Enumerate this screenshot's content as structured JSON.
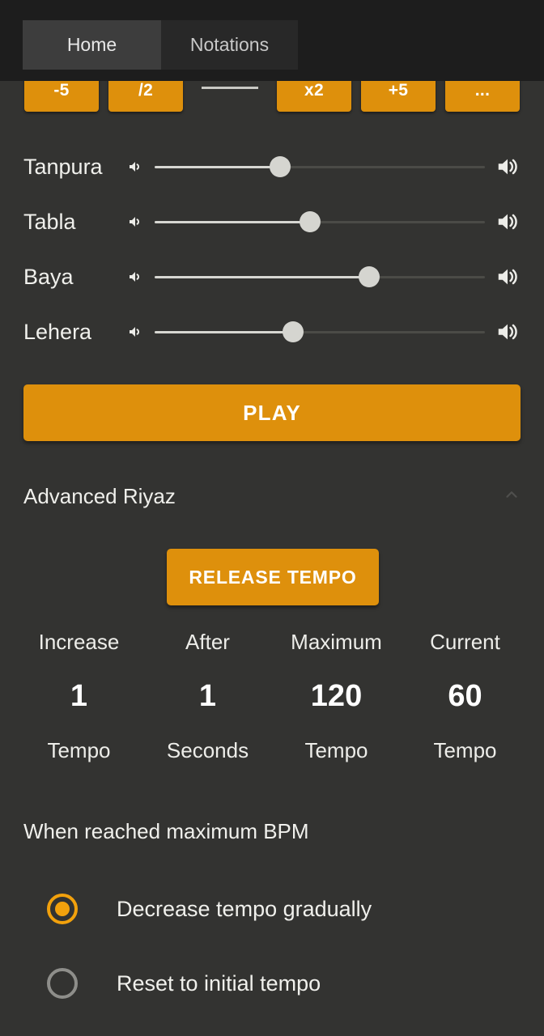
{
  "tabs": [
    {
      "label": "Home",
      "active": true
    },
    {
      "label": "Notations",
      "active": false
    }
  ],
  "tempo_controls": {
    "buttons": [
      "-5",
      "/2",
      "x2",
      "+5",
      "..."
    ],
    "display_value": ""
  },
  "volume_sliders": [
    {
      "label": "Tanpura",
      "value": 38,
      "low_icon": "volume-low-icon",
      "high_icon": "volume-high-icon"
    },
    {
      "label": "Tabla",
      "value": 47,
      "low_icon": "volume-low-icon",
      "high_icon": "volume-high-icon"
    },
    {
      "label": "Baya",
      "value": 65,
      "low_icon": "volume-low-icon",
      "high_icon": "volume-high-icon"
    },
    {
      "label": "Lehera",
      "value": 42,
      "low_icon": "volume-low-icon",
      "high_icon": "volume-high-icon"
    }
  ],
  "play_button": {
    "label": "PLAY"
  },
  "advanced_section": {
    "title": "Advanced Riyaz",
    "release_button": "RELEASE TEMPO",
    "stats": [
      {
        "top": "Increase",
        "value": "1",
        "unit": "Tempo"
      },
      {
        "top": "After",
        "value": "1",
        "unit": "Seconds"
      },
      {
        "top": "Maximum",
        "value": "120",
        "unit": "Tempo"
      },
      {
        "top": "Current",
        "value": "60",
        "unit": "Tempo"
      }
    ]
  },
  "max_bpm": {
    "title": "When reached maximum BPM",
    "options": [
      {
        "label": "Decrease tempo gradually",
        "selected": true
      },
      {
        "label": "Reset to initial tempo",
        "selected": false
      }
    ]
  },
  "colors": {
    "accent_orange": "#DE900C",
    "radio_orange": "#F2A10C",
    "background": "#333331",
    "overlay_dark": "#1d1d1d",
    "tab_active": "#3d3d3d",
    "tab_inactive": "#282828"
  }
}
